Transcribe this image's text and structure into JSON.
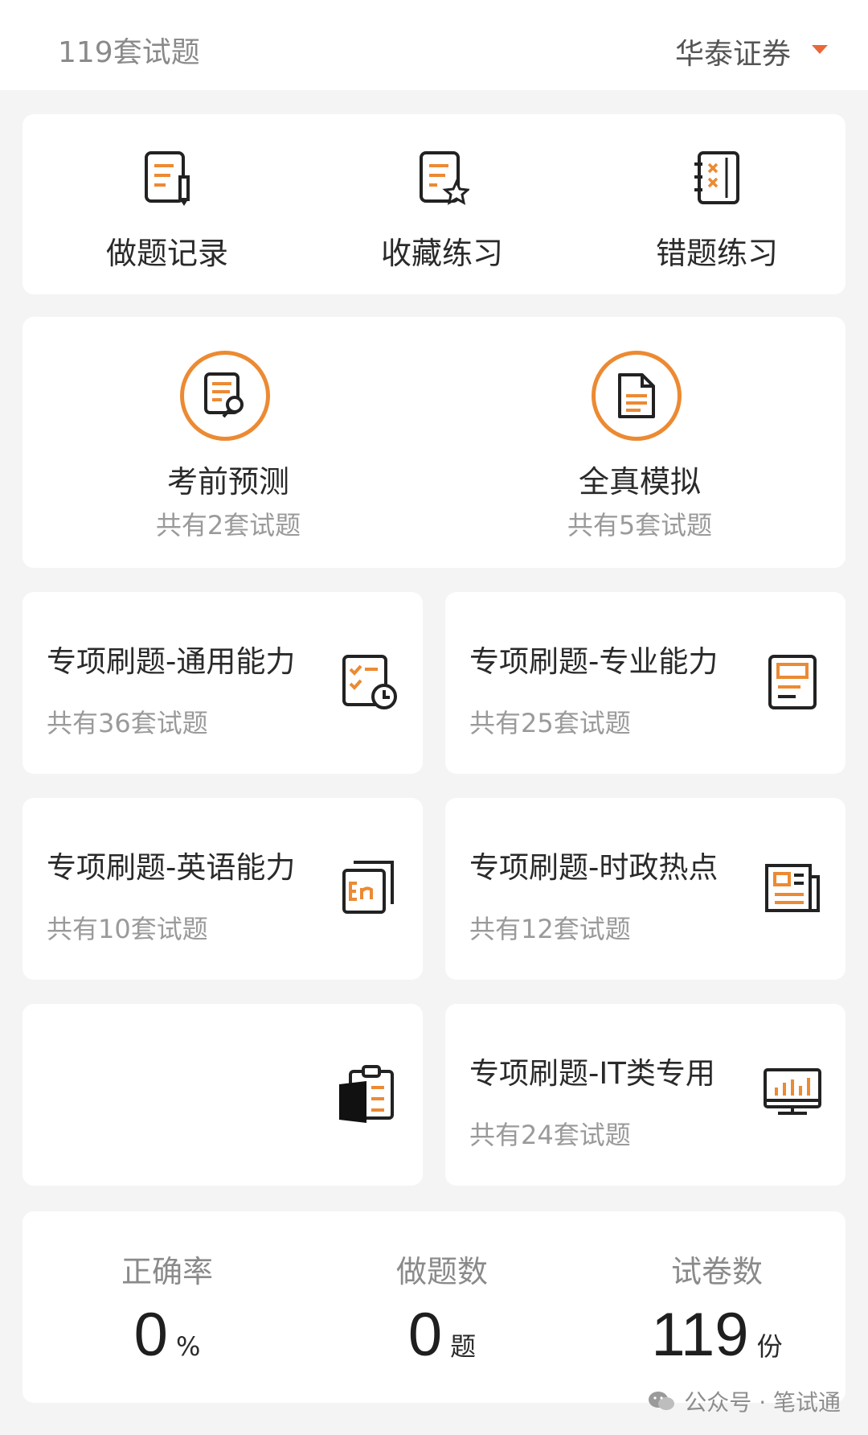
{
  "header": {
    "exam_count": "119套试题",
    "company": "华泰证券"
  },
  "quick_actions": [
    {
      "label": "做题记录",
      "icon": "record-icon"
    },
    {
      "label": "收藏练习",
      "icon": "favorite-icon"
    },
    {
      "label": "错题练习",
      "icon": "mistake-notebook-icon"
    }
  ],
  "featured": [
    {
      "title": "考前预测",
      "subtitle": "共有2套试题",
      "icon": "document-search-icon"
    },
    {
      "title": "全真模拟",
      "subtitle": "共有5套试题",
      "icon": "document-icon"
    }
  ],
  "practice": [
    {
      "title": "专项刷题-通用能力",
      "subtitle": "共有36套试题",
      "icon": "checklist-clock-icon"
    },
    {
      "title": "专项刷题-专业能力",
      "subtitle": "共有25套试题",
      "icon": "form-icon"
    },
    {
      "title": "专项刷题-英语能力",
      "subtitle": "共有10套试题",
      "icon": "english-icon"
    },
    {
      "title": "专项刷题-时政热点",
      "subtitle": "共有12套试题",
      "icon": "newspaper-icon"
    },
    {
      "title": "",
      "subtitle": "",
      "icon": "clipboard-icon"
    },
    {
      "title": "专项刷题-IT类专用",
      "subtitle": "共有24套试题",
      "icon": "monitor-chart-icon"
    }
  ],
  "stats": [
    {
      "label": "正确率",
      "value": "0",
      "unit": "%"
    },
    {
      "label": "做题数",
      "value": "0",
      "unit": "题"
    },
    {
      "label": "试卷数",
      "value": "119",
      "unit": "份"
    }
  ],
  "watermark": "公众号 · 笔试通",
  "colors": {
    "accent": "#ec8a33",
    "caret": "#e8683a",
    "background": "#f4f4f5"
  }
}
